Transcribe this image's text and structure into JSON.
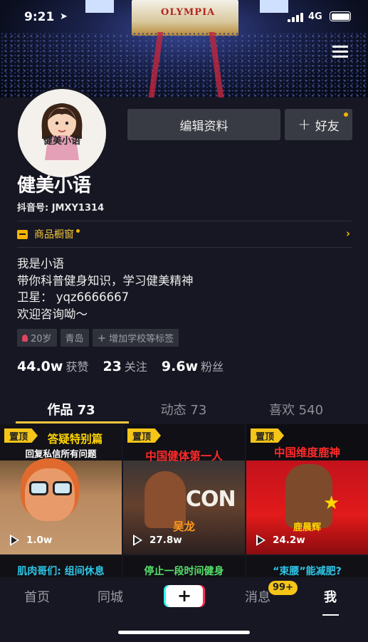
{
  "status_bar": {
    "time": "9:21",
    "network": "4G"
  },
  "banner": {
    "logo_text": "OLYMPIA"
  },
  "profile": {
    "avatar_caption": "健美小语",
    "nickname": "健美小语",
    "douyin_id": "抖音号: JMXY1314",
    "edit_button": "编辑资料",
    "friend_button": "好友",
    "shop_label": "商品橱窗",
    "bio": [
      "我是小语",
      "带你科普健身知识，学习健美精神",
      "卫星： yqz6666667",
      "欢迎咨询呦～"
    ],
    "tags": [
      "20岁",
      "青岛",
      "增加学校等标签"
    ],
    "stats": {
      "likes_value": "44.0w",
      "likes_label": "获赞",
      "following_value": "23",
      "following_label": "关注",
      "fans_value": "9.6w",
      "fans_label": "粉丝"
    }
  },
  "tabs": [
    {
      "label": "作品 73",
      "active": true
    },
    {
      "label": "动态 73",
      "active": false
    },
    {
      "label": "喜欢 540",
      "active": false
    }
  ],
  "videos": [
    {
      "pinned_label": "置顶",
      "title": "答疑特别篇",
      "subtitle": "回复私信所有问题",
      "plays": "1.0w"
    },
    {
      "pinned_label": "置顶",
      "title": "中国健体第一人",
      "name_caption": "吴龙",
      "overlay_text": "CON",
      "plays": "27.8w"
    },
    {
      "pinned_label": "置顶",
      "title": "中国维度鹿神",
      "name_caption": "鹿晨辉",
      "plays": "24.2w"
    },
    {
      "title": "肌肉哥们: 组间休息"
    },
    {
      "title": "停止一段时间健身"
    },
    {
      "title": "“束腰”能减肥?"
    }
  ],
  "bottom_nav": {
    "home": "首页",
    "local": "同城",
    "add": "+",
    "messages": "消息",
    "messages_badge": "99+",
    "me": "我"
  },
  "colors": {
    "accent_yellow": "#f5c518",
    "background": "#161722",
    "brand_red": "#fe2c55",
    "brand_cyan": "#27f4ee"
  }
}
